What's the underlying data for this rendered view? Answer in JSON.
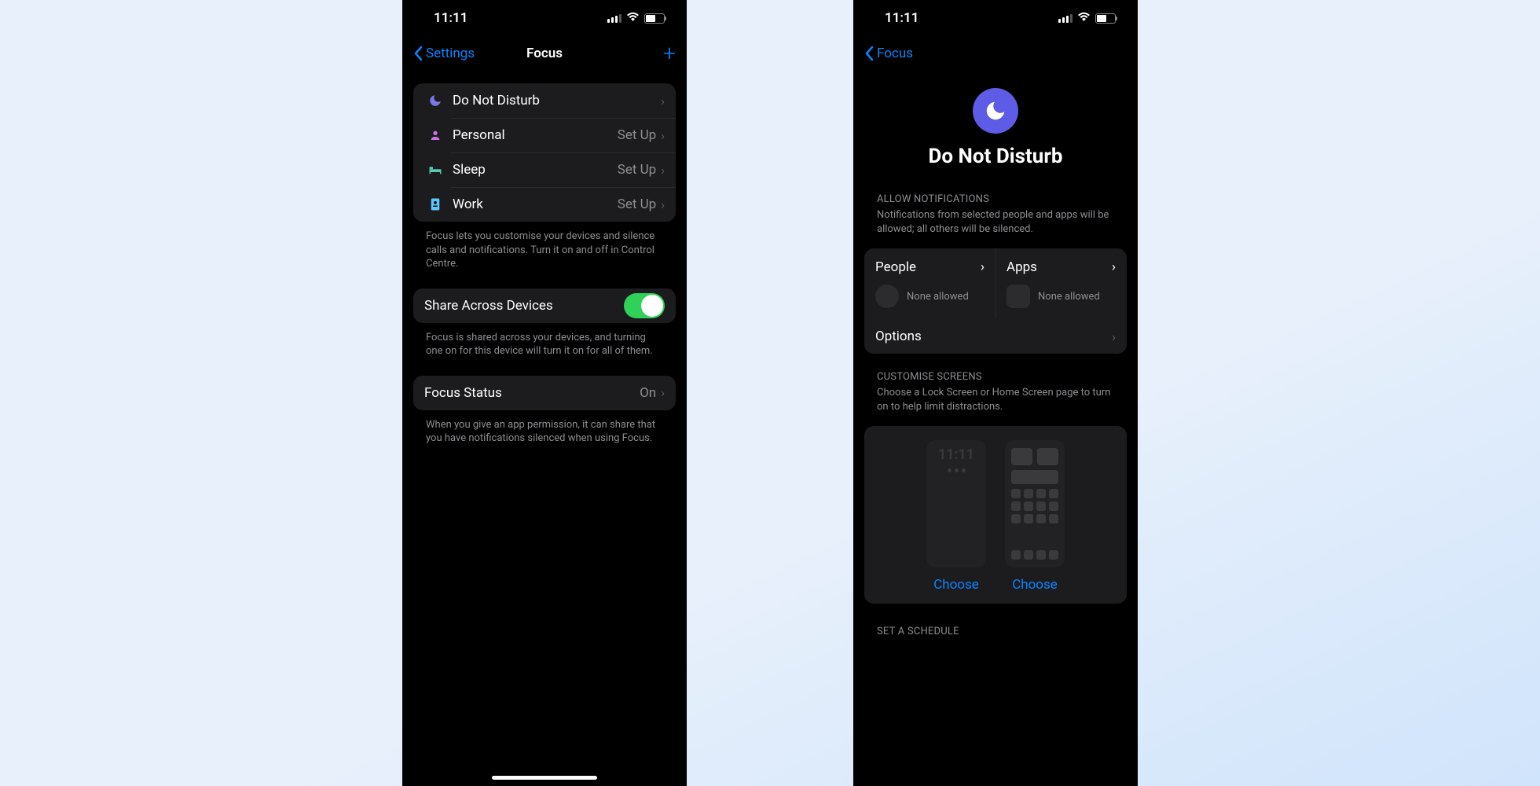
{
  "status": {
    "time": "11:11"
  },
  "left": {
    "back": "Settings",
    "title": "Focus",
    "modes": [
      {
        "label": "Do Not Disturb",
        "detail": "",
        "icon": "🌙",
        "color": "#5e5ce6"
      },
      {
        "label": "Personal",
        "detail": "Set Up",
        "icon": "👤",
        "color": "#c774e8"
      },
      {
        "label": "Sleep",
        "detail": "Set Up",
        "icon": "🛏",
        "color": "#5ac8b0"
      },
      {
        "label": "Work",
        "detail": "Set Up",
        "icon": "📋",
        "color": "#5ac8fa"
      }
    ],
    "modes_caption": "Focus lets you customise your devices and silence calls and notifications. Turn it on and off in Control Centre.",
    "share_label": "Share Across Devices",
    "share_caption": "Focus is shared across your devices, and turning one on for this device will turn it on for all of them.",
    "status_label": "Focus Status",
    "status_value": "On",
    "status_caption": "When you give an app permission, it can share that you have notifications silenced when using Focus."
  },
  "right": {
    "back": "Focus",
    "title": "Do Not Disturb",
    "allow_header": "ALLOW NOTIFICATIONS",
    "allow_desc": "Notifications from selected people and apps will be allowed; all others will be silenced.",
    "people_label": "People",
    "apps_label": "Apps",
    "none": "None allowed",
    "options": "Options",
    "cust_header": "CUSTOMISE SCREENS",
    "cust_desc": "Choose a Lock Screen or Home Screen page to turn on to help limit distractions.",
    "choose": "Choose",
    "mock_time": "11:11",
    "schedule_header": "SET A SCHEDULE"
  }
}
